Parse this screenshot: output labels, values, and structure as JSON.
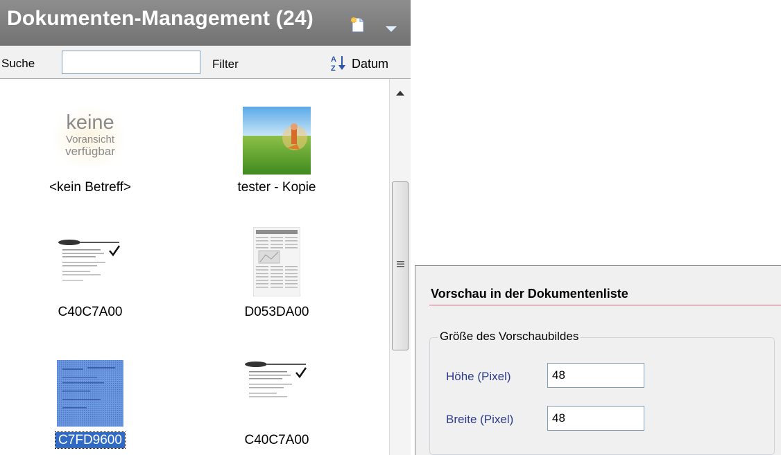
{
  "document_panel": {
    "title": "Dokumenten-Management (24)",
    "header_icons": [
      "new-document-icon",
      "chevron-down-icon"
    ],
    "toolbar": {
      "search_label": "Suche",
      "search_value": "",
      "filter_label": "Filter",
      "sort_icon": "sort-az-icon",
      "sort_label": "Datum"
    },
    "no_preview_text": [
      "keine",
      "Voransicht",
      "verfügbar"
    ],
    "documents": [
      {
        "label": "<kein Betreff>",
        "thumbnail": "no-preview",
        "selected": false
      },
      {
        "label": "tester - Kopie",
        "thumbnail": "photo-field-figure",
        "selected": false
      },
      {
        "label": "C40C7A00",
        "thumbnail": "scanned-letter",
        "selected": false
      },
      {
        "label": "D053DA00",
        "thumbnail": "newspaper-page",
        "selected": false
      },
      {
        "label": "C7FD9600",
        "thumbnail": "scanned-letter-selected",
        "selected": true
      },
      {
        "label": "C40C7A00",
        "thumbnail": "scanned-letter",
        "selected": false
      }
    ]
  },
  "settings_panel": {
    "title": "Vorschau in der Dokumentenliste",
    "group_title": "Größe des Vorschaubildes",
    "height_label": "Höhe (Pixel)",
    "height_value": "48",
    "width_label": "Breite (Pixel)",
    "width_value": "48"
  },
  "colors": {
    "header_bg": "#7f7f7f",
    "selection": "#316ac5",
    "field_label": "#2c3b8c",
    "underline": "#d95b7a"
  }
}
